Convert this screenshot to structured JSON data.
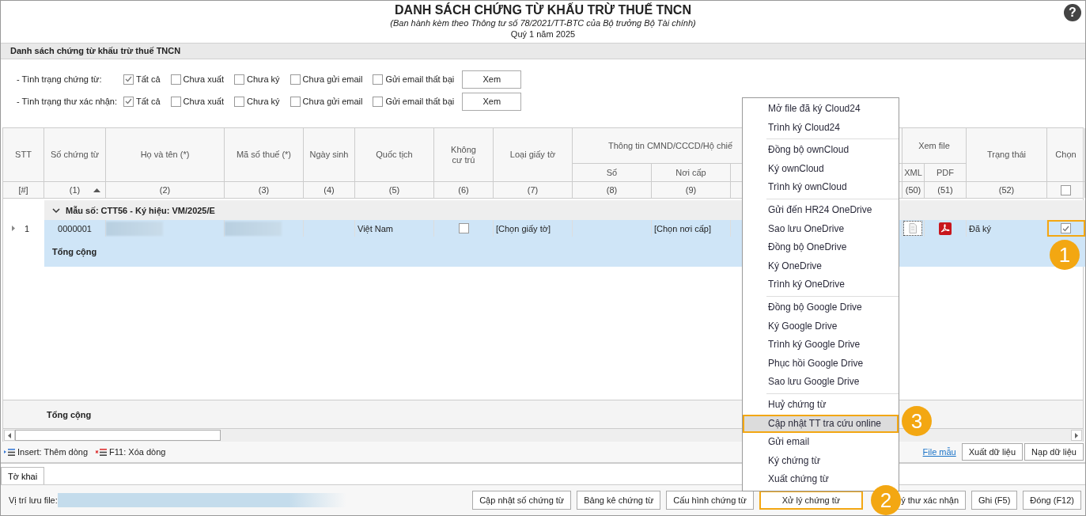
{
  "header": {
    "title": "DANH SÁCH CHỨNG TỪ KHẤU TRỪ THUẾ TNCN",
    "subtitle": "(Ban hành kèm theo Thông tư số 78/2021/TT-BTC của Bộ trưởng Bộ Tài chính)",
    "period": "Quý 1 năm 2025",
    "help": "?"
  },
  "section_title": "Danh sách chứng từ khấu trừ thuế TNCN",
  "filters": [
    {
      "label": "- Tình trạng chứng từ:",
      "options": [
        {
          "label": "Tất cả",
          "checked": true
        },
        {
          "label": "Chưa xuất",
          "checked": false
        },
        {
          "label": "Chưa ký",
          "checked": false
        },
        {
          "label": "Chưa gửi email",
          "checked": false
        },
        {
          "label": "Gửi email thất bại",
          "checked": false
        }
      ],
      "button": "Xem"
    },
    {
      "label": "- Tình trạng thư xác nhận:",
      "options": [
        {
          "label": "Tất cả",
          "checked": true
        },
        {
          "label": "Chưa xuất",
          "checked": false
        },
        {
          "label": "Chưa ký",
          "checked": false
        },
        {
          "label": "Chưa gửi email",
          "checked": false
        },
        {
          "label": "Gửi email thất bại",
          "checked": false
        }
      ],
      "button": "Xem"
    }
  ],
  "table": {
    "columns": [
      {
        "label": "STT",
        "index": "[#]"
      },
      {
        "label": "Số chứng từ",
        "index": "(1)",
        "sorted": true
      },
      {
        "label": "Họ và tên (*)",
        "index": "(2)"
      },
      {
        "label": "Mã số thuế (*)",
        "index": "(3)"
      },
      {
        "label": "Ngày sinh",
        "index": "(4)"
      },
      {
        "label": "Quốc tịch",
        "index": "(5)"
      },
      {
        "label": "Không\ncư trú",
        "index": "(6)"
      },
      {
        "label": "Loại giấy tờ",
        "index": "(7)"
      },
      {
        "label": "Số",
        "index": "(8)",
        "in_group": true
      },
      {
        "label": "Nơi cấp",
        "index": "(9)",
        "in_group": true
      },
      {
        "label": "XML",
        "index": "(50)",
        "in_group": true
      },
      {
        "label": "PDF",
        "index": "(51)",
        "in_group": true
      },
      {
        "label": "Trạng thái",
        "index": "(52)"
      },
      {
        "label": "Chọn",
        "select_all": {
          "checked": false
        }
      }
    ],
    "column_groups": [
      {
        "label": "Thông tin CMND/CCCD/Hộ chiế"
      },
      {
        "label": "Xem file"
      }
    ],
    "group": {
      "label": "Mẫu số: CTT56 - Ký hiệu: VM/2025/E",
      "expanded": true
    },
    "rows": [
      {
        "selected": true,
        "cells": [
          {
            "kind": "row_number",
            "text": "1"
          },
          {
            "kind": "text_center",
            "text": "0000001"
          },
          {
            "kind": "redacted"
          },
          {
            "kind": "redacted"
          },
          {
            "kind": "empty"
          },
          {
            "kind": "text",
            "text": "Việt Nam"
          },
          {
            "kind": "checkbox",
            "checked": false
          },
          {
            "kind": "text",
            "text": "[Chọn giấy tờ]"
          },
          {
            "kind": "empty"
          },
          {
            "kind": "text",
            "text": "[Chọn nơi cấp]"
          },
          {
            "kind": "xml_file"
          },
          {
            "kind": "pdf_file"
          },
          {
            "kind": "text",
            "text": "Đã ký"
          },
          {
            "kind": "checkbox",
            "checked": true,
            "highlighted": true
          }
        ]
      }
    ],
    "group_total": "Tổng cộng",
    "footer_total": "Tổng cộng"
  },
  "toolbar": {
    "actions": [
      {
        "kind": "add",
        "label": "Insert: Thêm dòng"
      },
      {
        "kind": "delete",
        "label": "F11: Xóa dòng"
      }
    ],
    "link": "File mẫu",
    "buttons": [
      "Xuất dữ liệu",
      "Nạp dữ liệu"
    ]
  },
  "tabs": [
    {
      "label": "Tờ khai",
      "selected": true
    }
  ],
  "bottom_bar": {
    "location_label": "Vị trí lưu file:",
    "location_redacted": true,
    "buttons": [
      {
        "label": "Cập nhật số chứng từ",
        "highlighted": false
      },
      {
        "label": "Bảng kê chứng từ",
        "highlighted": false
      },
      {
        "label": "Cấu hình chứng từ",
        "highlighted": false
      },
      {
        "label": "Xử lý chứng từ",
        "highlighted": true
      },
      {
        "label": "ý thư xác nhận",
        "highlighted": false
      },
      {
        "label": "Ghi (F5)",
        "highlighted": false
      },
      {
        "label": "Đóng (F12)",
        "highlighted": false
      }
    ]
  },
  "context_menu": {
    "groups": [
      [
        {
          "label": "Mở file đã ký Cloud24",
          "highlighted": false
        },
        {
          "label": "Trình ký Cloud24",
          "highlighted": false
        }
      ],
      [
        {
          "label": "Đồng bộ ownCloud",
          "highlighted": false
        },
        {
          "label": "Ký ownCloud",
          "highlighted": false
        },
        {
          "label": "Trình ký ownCloud",
          "highlighted": false
        }
      ],
      [
        {
          "label": "Gửi đến HR24 OneDrive",
          "highlighted": false
        },
        {
          "label": "Sao lưu OneDrive",
          "highlighted": false
        },
        {
          "label": "Đồng bộ OneDrive",
          "highlighted": false
        },
        {
          "label": "Ký OneDrive",
          "highlighted": false
        },
        {
          "label": "Trình ký OneDrive",
          "highlighted": false
        }
      ],
      [
        {
          "label": "Đồng bộ Google Drive",
          "highlighted": false
        },
        {
          "label": "Ký Google Drive",
          "highlighted": false
        },
        {
          "label": "Trình ký Google Drive",
          "highlighted": false
        },
        {
          "label": "Phục hồi Google Drive",
          "highlighted": false
        },
        {
          "label": "Sao lưu Google Drive",
          "highlighted": false
        }
      ],
      [
        {
          "label": "Huỷ chứng từ",
          "highlighted": false
        },
        {
          "label": "Cập nhật TT tra cứu online",
          "highlighted": true
        },
        {
          "label": "Gửi email",
          "highlighted": false
        },
        {
          "label": "Ký chứng từ",
          "highlighted": false
        },
        {
          "label": "Xuất chứng từ",
          "highlighted": false
        }
      ]
    ]
  },
  "callouts": [
    "1",
    "2",
    "3"
  ]
}
